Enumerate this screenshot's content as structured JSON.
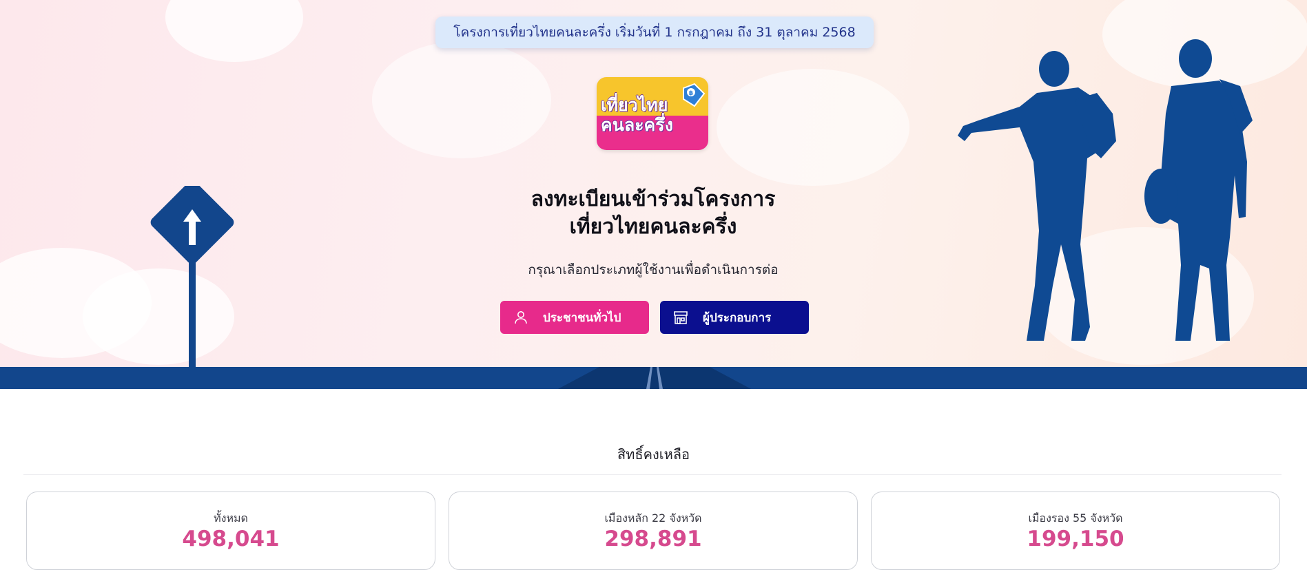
{
  "notice": "โครงการเที่ยวไทยคนละครึ่ง เริ่มวันที่ 1 กรกฎาคม ถึง 31 ตุลาคม 2568",
  "logo": {
    "line1": "เที่ยวไทย",
    "line2": "คนละครึ่ง"
  },
  "hero": {
    "title_line1": "ลงทะเบียนเข้าร่วมโครงการ",
    "title_line2": "เที่ยวไทยคนละครึ่ง",
    "subtitle": "กรุณาเลือกประเภทผู้ใช้งานเพื่อดำเนินการต่อ"
  },
  "buttons": {
    "citizen": {
      "label": "ประชาชนทั่วไป",
      "icon": "user-icon",
      "color": "#e72a8b"
    },
    "merchant": {
      "label": "ผู้ประกอบการ",
      "icon": "store-icon",
      "color": "#0b0f8f"
    }
  },
  "rights": {
    "title": "สิทธิ์คงเหลือ",
    "cards": [
      {
        "label": "ทั้งหมด",
        "value": "498,041"
      },
      {
        "label": "เมืองหลัก 22 จังหวัด",
        "value": "298,891"
      },
      {
        "label": "เมืองรอง 55 จังหวัด",
        "value": "199,150"
      }
    ]
  },
  "colors": {
    "accent_pink": "#e72a8b",
    "navy": "#0b0f8f",
    "ground_blue": "#12468c",
    "value_pink": "#d64a8e"
  }
}
